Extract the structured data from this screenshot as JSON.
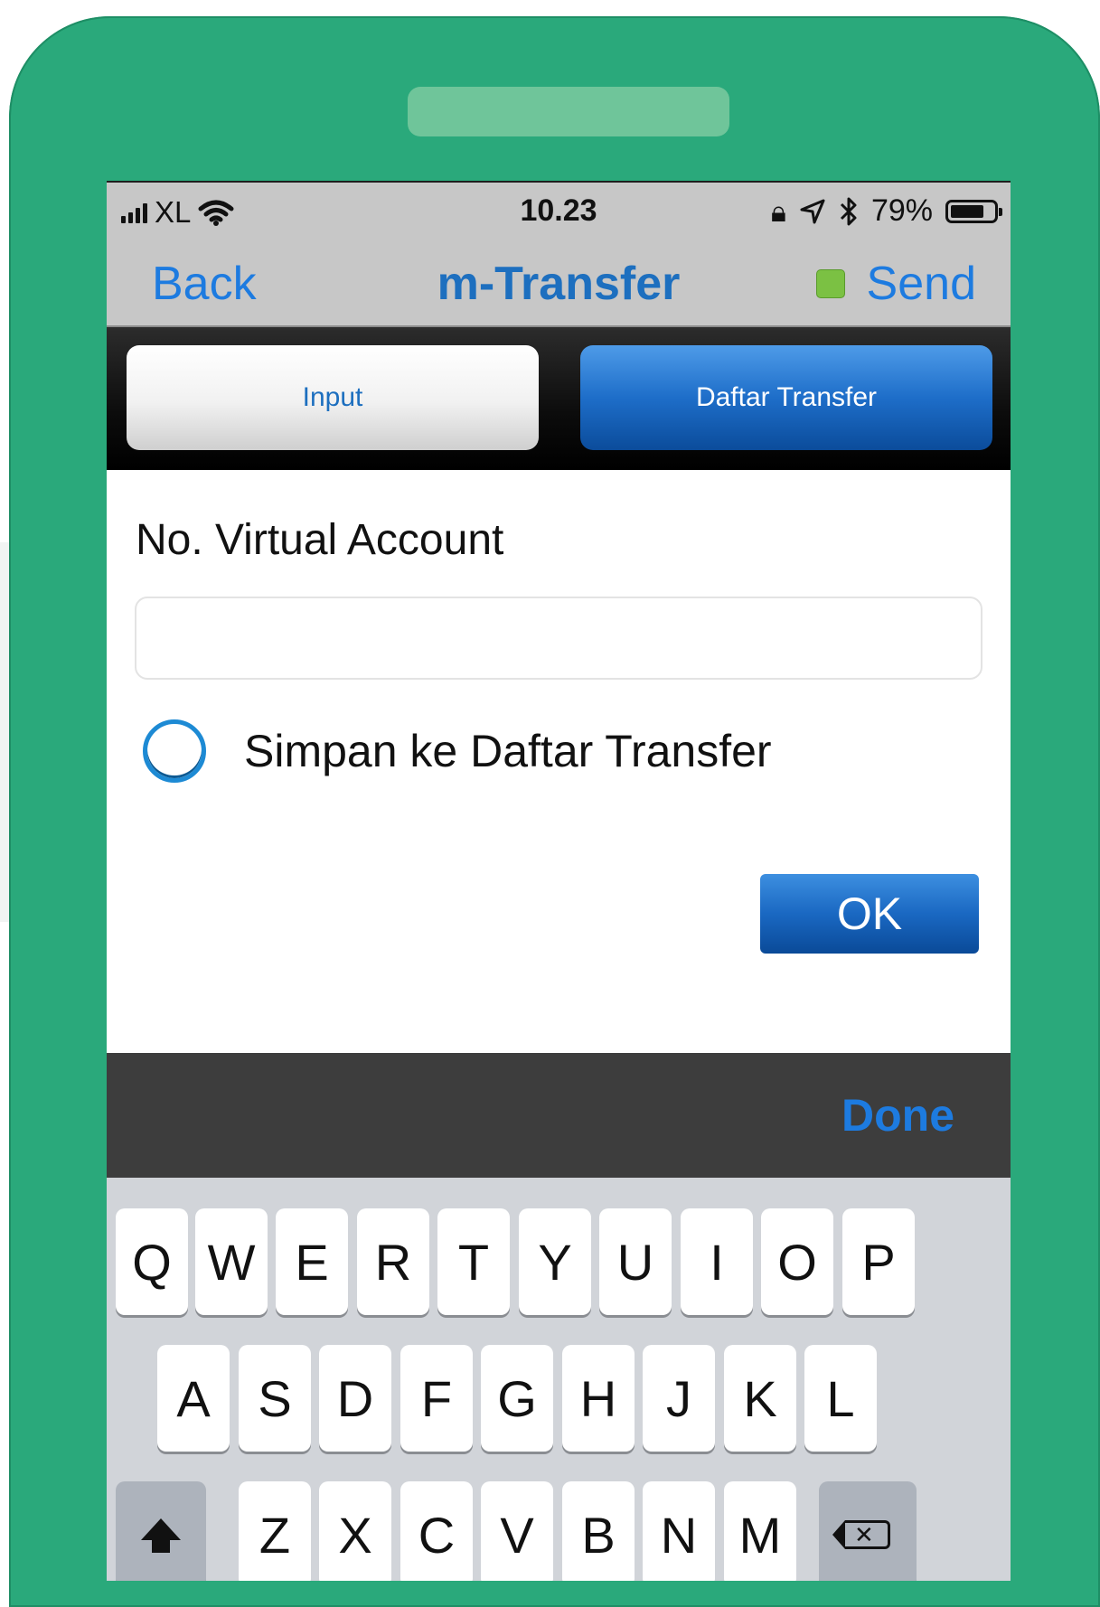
{
  "status_bar": {
    "carrier": "XL",
    "time": "10.23",
    "battery_percent": "79%",
    "battery_level": 0.79,
    "icons": [
      "signal-icon",
      "wifi-icon",
      "rotation-lock-icon",
      "location-icon",
      "bluetooth-icon",
      "battery-icon"
    ]
  },
  "nav": {
    "back_label": "Back",
    "title": "m-Transfer",
    "send_label": "Send",
    "send_indicator_color": "#7bc143"
  },
  "tabs": [
    {
      "label": "Input",
      "selected": false
    },
    {
      "label": "Daftar Transfer",
      "selected": true
    }
  ],
  "form": {
    "va_label": "No. Virtual Account",
    "va_value": "",
    "va_placeholder": "",
    "save_option_label": "Simpan ke Daftar Transfer",
    "save_option_checked": false,
    "ok_label": "OK"
  },
  "accessory": {
    "done_label": "Done"
  },
  "keyboard": {
    "row1": [
      "Q",
      "W",
      "E",
      "R",
      "T",
      "Y",
      "U",
      "I",
      "O",
      "P"
    ],
    "row2": [
      "A",
      "S",
      "D",
      "F",
      "G",
      "H",
      "J",
      "K",
      "L"
    ],
    "row3": [
      "Z",
      "X",
      "C",
      "V",
      "B",
      "N",
      "M"
    ]
  },
  "colors": {
    "frame": "#2aa97b",
    "accent": "#1d7be0",
    "title": "#1d6fbf"
  }
}
